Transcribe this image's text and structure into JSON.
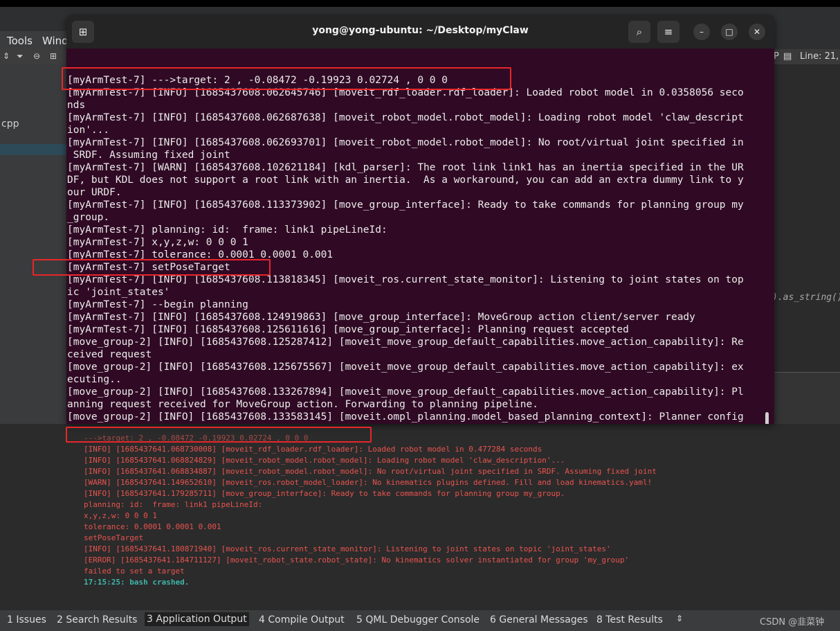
{
  "terminal": {
    "title": "yong@yong-ubuntu: ~/Desktop/myClaw",
    "lines": [
      "[myArmTest-7] --->target: 2 , -0.08472 -0.19923 0.02724 , 0 0 0",
      "[myArmTest-7] [INFO] [1685437608.062645746] [moveit_rdf_loader.rdf_loader]: Loaded robot model in 0.0358056 seco",
      "nds",
      "[myArmTest-7] [INFO] [1685437608.062687638] [moveit_robot_model.robot_model]: Loading robot model 'claw_descript",
      "ion'...",
      "[myArmTest-7] [INFO] [1685437608.062693701] [moveit_robot_model.robot_model]: No root/virtual joint specified in",
      " SRDF. Assuming fixed joint",
      "[myArmTest-7] [WARN] [1685437608.102621184] [kdl_parser]: The root link link1 has an inertia specified in the UR",
      "DF, but KDL does not support a root link with an inertia.  As a workaround, you can add an extra dummy link to y",
      "our URDF.",
      "[myArmTest-7] [INFO] [1685437608.113373902] [move_group_interface]: Ready to take commands for planning group my",
      "_group.",
      "[myArmTest-7] planning: id:  frame: link1 pipeLineId:",
      "[myArmTest-7] x,y,z,w: 0 0 0 1",
      "[myArmTest-7] tolerance: 0.0001 0.0001 0.001",
      "[myArmTest-7] setPoseTarget",
      "[myArmTest-7] [INFO] [1685437608.113818345] [moveit_ros.current_state_monitor]: Listening to joint states on top",
      "ic 'joint_states'",
      "[myArmTest-7] --begin planning",
      "[myArmTest-7] [INFO] [1685437608.124919863] [move_group_interface]: MoveGroup action client/server ready",
      "[myArmTest-7] [INFO] [1685437608.125611616] [move_group_interface]: Planning request accepted",
      "[move_group-2] [INFO] [1685437608.125287412] [moveit_move_group_default_capabilities.move_action_capability]: Re",
      "ceived request",
      "[move_group-2] [INFO] [1685437608.125675567] [moveit_move_group_default_capabilities.move_action_capability]: ex",
      "ecuting..",
      "[move_group-2] [INFO] [1685437608.133267894] [moveit_move_group_default_capabilities.move_action_capability]: Pl",
      "anning request received for MoveGroup action. Forwarding to planning pipeline.",
      "[move_group-2] [INFO] [1685437608.133583145] [moveit.ompl_planning.model_based_planning_context]: Planner config"
    ]
  },
  "menubar": {
    "tools": "Tools",
    "window": "Wind"
  },
  "sidebar": {
    "file_label": "cpp"
  },
  "right_toolbar": {
    "line_col": "Line: 21,"
  },
  "right_editor": {
    "code": ").as_string()"
  },
  "output": {
    "lines": [
      {
        "text": "--->target: 2 , -0.08472 -0.19923 0.02724 , 0 0 0",
        "style": "faded"
      },
      {
        "text": "[INFO] [1685437641.068730008] [moveit_rdf_loader.rdf_loader]: Loaded robot model in 0.477284 seconds",
        "style": "red"
      },
      {
        "text": "[INFO] [1685437641.068824829] [moveit_robot_model.robot_model]: Loading robot model 'claw_description'...",
        "style": "red"
      },
      {
        "text": "[INFO] [1685437641.068834887] [moveit_robot_model.robot_model]: No root/virtual joint specified in SRDF. Assuming fixed joint",
        "style": "red"
      },
      {
        "text": "[WARN] [1685437641.149652610] [moveit_ros.robot_model_loader]: No kinematics plugins defined. Fill and load kinematics.yaml!",
        "style": "red"
      },
      {
        "text": "[INFO] [1685437641.179285711] [move_group_interface]: Ready to take commands for planning group my_group.",
        "style": "red"
      },
      {
        "text": "planning: id:  frame: link1 pipeLineId:",
        "style": "red"
      },
      {
        "text": "x,y,z,w: 0 0 0 1",
        "style": "red"
      },
      {
        "text": "tolerance: 0.0001 0.0001 0.001",
        "style": "red"
      },
      {
        "text": "setPoseTarget",
        "style": "red"
      },
      {
        "text": "[INFO] [1685437641.180871940] [moveit_ros.current_state_monitor]: Listening to joint states on topic 'joint_states'",
        "style": "red"
      },
      {
        "text": "[ERROR] [1685437641.184711127] [moveit_robot_state.robot_state]: No kinematics solver instantiated for group 'my_group'",
        "style": "red"
      },
      {
        "text": "failed to set a target",
        "style": "red"
      },
      {
        "text": "17:15:25: bash crashed.",
        "style": "green"
      }
    ]
  },
  "bottom_tabs": [
    {
      "num": "1",
      "label": "Issues"
    },
    {
      "num": "2",
      "label": "Search Results"
    },
    {
      "num": "3",
      "label": "Application Output",
      "active": true
    },
    {
      "num": "4",
      "label": "Compile Output"
    },
    {
      "num": "5",
      "label": "QML Debugger Console"
    },
    {
      "num": "6",
      "label": "General Messages"
    },
    {
      "num": "8",
      "label": "Test Results"
    }
  ],
  "watermark": "CSDN @韭菜钟",
  "colors": {
    "terminal_bg": "#300a24",
    "highlight_box": "#e8262a",
    "output_text": "#e8544f",
    "output_status": "#3fb5a7"
  }
}
